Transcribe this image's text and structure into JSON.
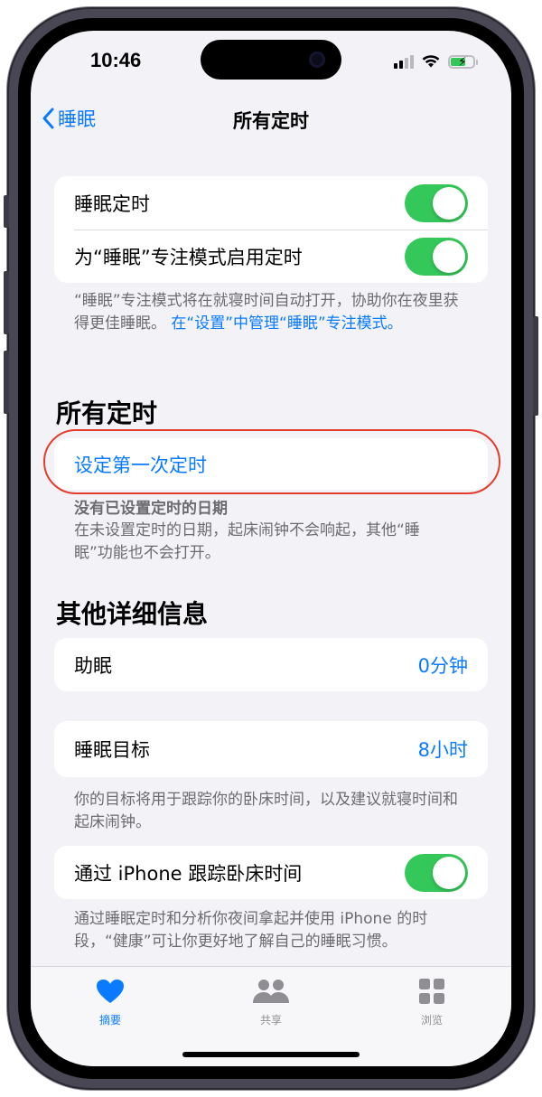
{
  "status_bar": {
    "time": "10:46"
  },
  "nav": {
    "back_label": "睡眠",
    "title": "所有定时"
  },
  "sleep_settings": {
    "sleep_schedule_label": "睡眠定时",
    "sleep_schedule_on": true,
    "focus_schedule_label": "为“睡眠”专注模式启用定时",
    "focus_schedule_on": true,
    "footnote_text": "“睡眠”专注模式将在就寝时间自动打开，协助你在夜里获得更佳睡眠。",
    "footnote_link": "在“设置”中管理“睡眠”专注模式。"
  },
  "all_schedules": {
    "header": "所有定时",
    "first_schedule_label": "设定第一次定时",
    "empty_title": "没有已设置定时的日期",
    "empty_text": "在未设置定时的日期，起床闹钟不会响起，其他“睡眠”功能也不会打开。"
  },
  "details": {
    "header": "其他详细信息",
    "wind_down_label": "助眠",
    "wind_down_value": "0分钟",
    "sleep_goal_label": "睡眠目标",
    "sleep_goal_value": "8小时",
    "goal_footnote": "你的目标将用于跟踪你的卧床时间，以及建议就寝时间和起床闹钟。",
    "track_label": "通过 iPhone 跟踪卧床时间",
    "track_on": true,
    "track_footnote": "通过睡眠定时和分析你夜间拿起并使用 iPhone 的时段，“健康”可让你更好地了解自己的睡眠习惯。"
  },
  "tab_bar": {
    "tabs": [
      {
        "label": "摘要",
        "icon": "heart-icon",
        "active": true
      },
      {
        "label": "共享",
        "icon": "people-icon",
        "active": false
      },
      {
        "label": "浏览",
        "icon": "grid-icon",
        "active": false
      }
    ]
  },
  "colors": {
    "accent": "#0a7aff",
    "toggle_on": "#34c759",
    "highlight": "#e53d2d",
    "background": "#f2f2f7"
  }
}
